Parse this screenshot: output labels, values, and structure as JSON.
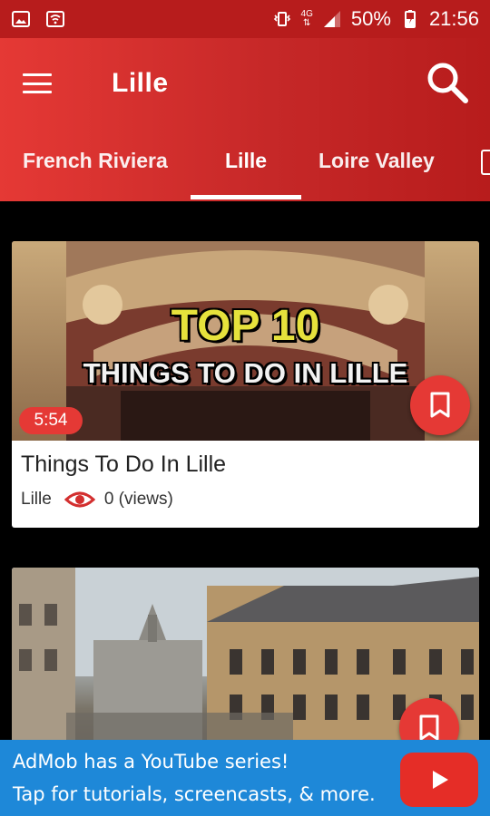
{
  "status_bar": {
    "network": "4G",
    "battery": "50%",
    "time": "21:56"
  },
  "toolbar": {
    "title": "Lille"
  },
  "tabs": [
    {
      "label": "French Riviera",
      "active": false
    },
    {
      "label": "Lille",
      "active": true
    },
    {
      "label": "Loire Valley",
      "active": false
    }
  ],
  "videos": [
    {
      "thumb_line1": "TOP 10",
      "thumb_line2": "THINGS TO DO IN LILLE",
      "duration": "5:54",
      "title": "Things To Do In Lille",
      "category": "Lille",
      "views": "0 (views)"
    }
  ],
  "ad_banner": {
    "line1": "AdMob has a YouTube series!",
    "line2": "Tap for tutorials, screencasts, & more."
  },
  "colors": {
    "primary": "#e53935",
    "primary_dark": "#b71c1c",
    "ad_blue": "#1e88d8"
  }
}
